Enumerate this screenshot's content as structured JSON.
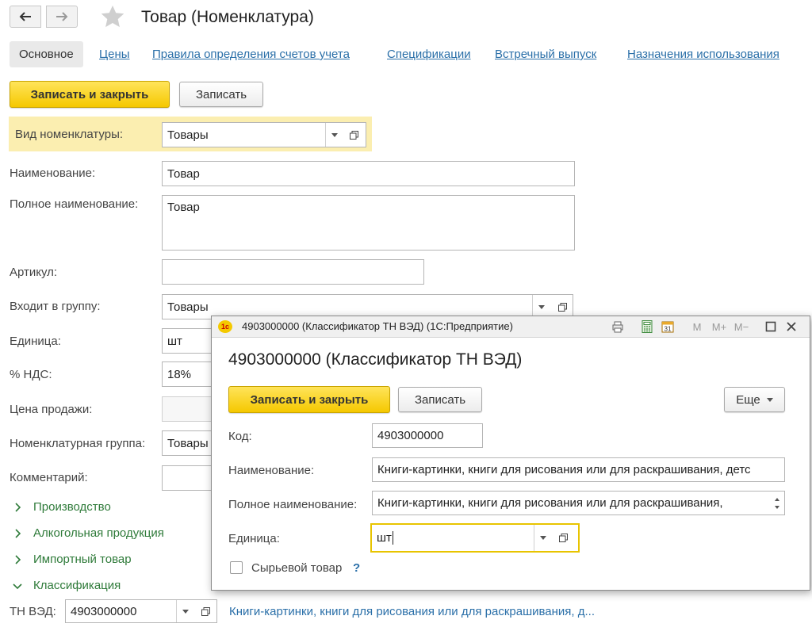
{
  "window": {
    "title": "Товар (Номенклатура)",
    "back_icon": "arrow-left-icon",
    "forward_icon": "arrow-right-icon",
    "favorite_icon": "star-icon"
  },
  "tabs": [
    {
      "label": "Основное",
      "active": true
    },
    {
      "label": "Цены"
    },
    {
      "label": "Правила определения счетов учета"
    },
    {
      "label": "Спецификации"
    },
    {
      "label": "Встречный выпуск"
    },
    {
      "label": "Назначения использования"
    }
  ],
  "toolbar": {
    "save_close_label": "Записать и закрыть",
    "save_label": "Записать"
  },
  "form": {
    "vid_label": "Вид номенклатуры:",
    "vid_value": "Товары",
    "name_label": "Наименование:",
    "name_value": "Товар",
    "fullname_label": "Полное наименование:",
    "fullname_value": "Товар",
    "article_label": "Артикул:",
    "article_value": "",
    "group_label": "Входит в группу:",
    "group_value": "Товары",
    "unit_label": "Единица:",
    "unit_value": "шт",
    "vat_label": "% НДС:",
    "vat_value": "18%",
    "price_label": "Цена продажи:",
    "price_value": "",
    "nomgroup_label": "Номенклатурная группа:",
    "nomgroup_value": "Товары",
    "comment_label": "Комментарий:",
    "comment_value": ""
  },
  "groups": [
    {
      "label": "Производство",
      "expanded": false
    },
    {
      "label": "Алкогольная продукция",
      "expanded": false
    },
    {
      "label": "Импортный товар",
      "expanded": false
    },
    {
      "label": "Классификация",
      "expanded": true
    }
  ],
  "tnved": {
    "label": "ТН ВЭД:",
    "value": "4903000000",
    "link": "Книги-картинки, книги для рисования или для раскрашивания, д..."
  },
  "dialog": {
    "window_title": "4903000000 (Классификатор ТН ВЭД)  (1С:Предприятие)",
    "logo": "1с",
    "header_title": "4903000000 (Классификатор ТН ВЭД)",
    "save_close_label": "Записать и закрыть",
    "save_label": "Записать",
    "more_label": "Еще",
    "code_label": "Код:",
    "code_value": "4903000000",
    "name_label": "Наименование:",
    "name_value": "Книги-картинки, книги для рисования или для раскрашивания, детс",
    "fullname_label": "Полное наименование:",
    "fullname_value": "Книги-картинки, книги для рисования или для раскрашивания,",
    "unit_label": "Единица:",
    "unit_value": "шт",
    "raw_label": "Сырьевой товар",
    "raw_checked": false,
    "help": "?",
    "m_label": "M",
    "mplus_label": "M+",
    "mminus_label": "M−",
    "calendar_day": "31"
  },
  "colors": {
    "accent_yellow": "#f5c800",
    "highlight_row": "#fbeeb0",
    "link_blue": "#2a6fa8",
    "group_green": "#2f7b3a",
    "focus_border": "#e8c400"
  }
}
